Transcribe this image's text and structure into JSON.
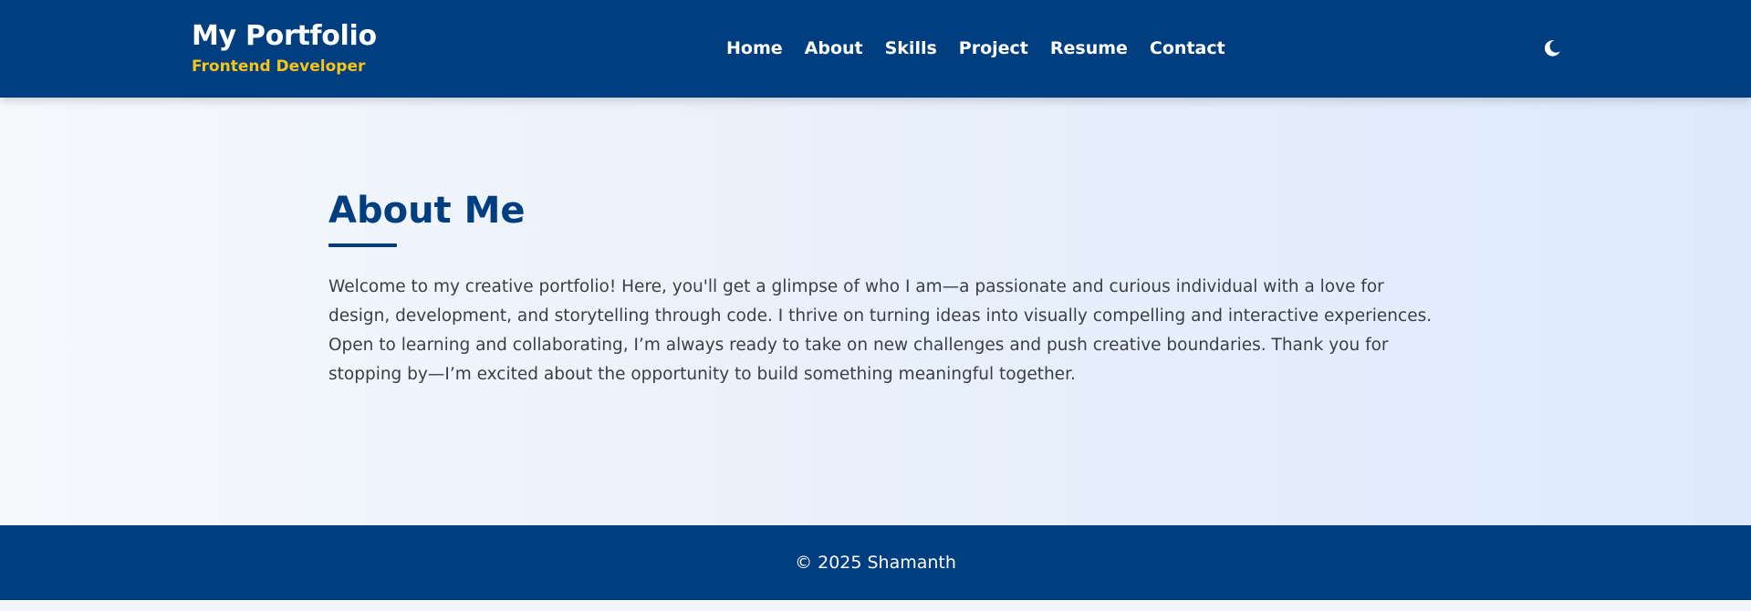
{
  "header": {
    "brand_title": "My Portfolio",
    "brand_subtitle": "Frontend Developer",
    "nav": [
      {
        "label": "Home"
      },
      {
        "label": "About"
      },
      {
        "label": "Skills"
      },
      {
        "label": "Project"
      },
      {
        "label": "Resume"
      },
      {
        "label": "Contact"
      }
    ],
    "theme_toggle_icon": "moon-icon"
  },
  "about": {
    "title": "About Me",
    "text": "Welcome to my creative portfolio! Here, you'll get a glimpse of who I am—a passionate and curious individual with a love for design, development, and storytelling through code. I thrive on turning ideas into visually compelling and interactive experiences. Open to learning and collaborating, I’m always ready to take on new challenges and push creative boundaries. Thank you for stopping by—I’m excited about the opportunity to build something meaningful together."
  },
  "footer": {
    "copyright": "© 2025 Shamanth"
  },
  "colors": {
    "primary": "#003e80",
    "accent": "#f5c518",
    "text": "#3a3f47",
    "background": "#eef3fb"
  }
}
